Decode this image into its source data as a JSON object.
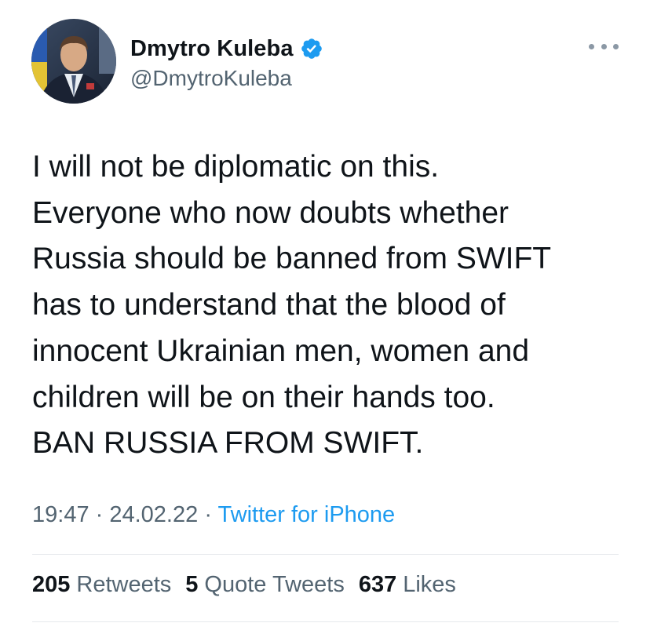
{
  "author": {
    "name": "Dmytro Kuleba",
    "handle": "@DmytroKuleba",
    "verified": true
  },
  "tweet": {
    "lines": [
      "I will not be diplomatic on this.",
      "Everyone who now doubts whether",
      "Russia should be banned from SWIFT",
      "has to understand that the blood of",
      "innocent Ukrainian men, women and",
      "children will be on their hands too.",
      "BAN RUSSIA FROM SWIFT."
    ]
  },
  "meta": {
    "time": "19:47",
    "separator": "·",
    "date": "24.02.22",
    "source": "Twitter for iPhone"
  },
  "stats": {
    "retweets_count": "205",
    "retweets_label": "Retweets",
    "quotes_count": "5",
    "quotes_label": "Quote Tweets",
    "likes_count": "637",
    "likes_label": "Likes"
  },
  "icons": {
    "verified": "verified-badge-icon",
    "more": "more-options-icon"
  },
  "colors": {
    "link": "#1d9bf0",
    "secondary_text": "#536471",
    "primary_text": "#0f1419"
  }
}
